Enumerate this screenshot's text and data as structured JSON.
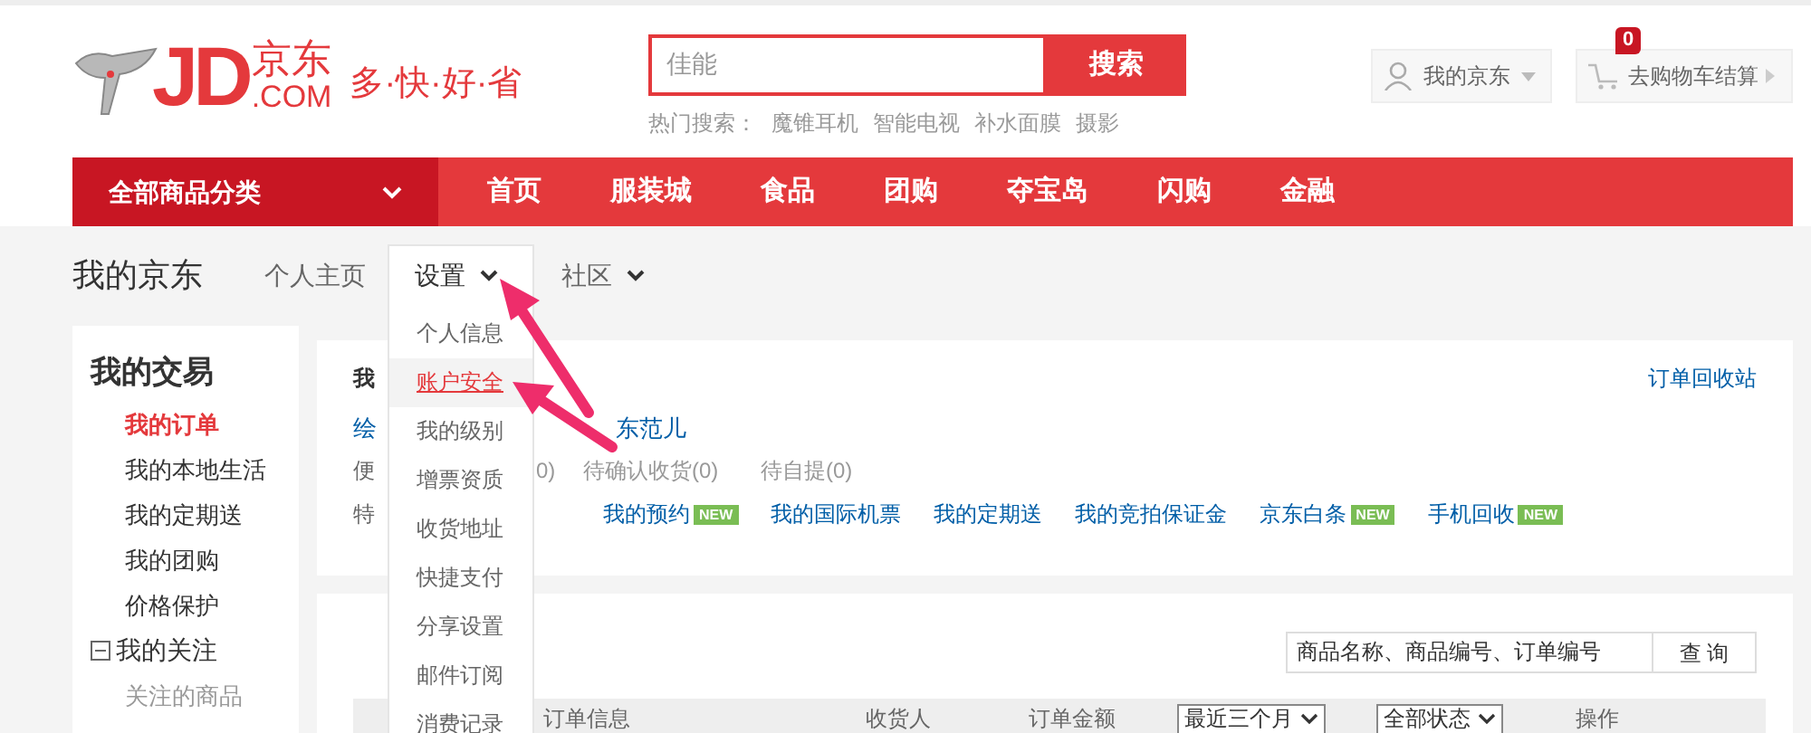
{
  "header": {
    "logo": {
      "brand": "JD",
      "cn": "京东",
      "domain": ".COM",
      "slogan": "多·快·好·省"
    },
    "search": {
      "value": "佳能",
      "button": "搜索",
      "hot_label": "热门搜索：",
      "hot": [
        "魔锥耳机",
        "智能电视",
        "补水面膜",
        "摄影"
      ]
    },
    "account": "我的京东",
    "cart": {
      "label": "去购物车结算",
      "count": "0"
    }
  },
  "nav": {
    "category": "全部商品分类",
    "items": [
      "首页",
      "服装城",
      "食品",
      "团购",
      "夺宝岛",
      "闪购",
      "金融"
    ]
  },
  "page": {
    "title": "我的京东",
    "tabs": [
      {
        "label": "个人主页",
        "has_menu": false,
        "expanded": false
      },
      {
        "label": "设置",
        "has_menu": true,
        "expanded": true
      },
      {
        "label": "社区",
        "has_menu": true,
        "expanded": false
      }
    ]
  },
  "settings_menu": {
    "items": [
      {
        "label": "个人信息",
        "selected": false
      },
      {
        "label": "账户安全",
        "selected": true
      },
      {
        "label": "我的级别",
        "selected": false
      },
      {
        "label": "增票资质",
        "selected": false
      },
      {
        "label": "收货地址",
        "selected": false
      },
      {
        "label": "快捷支付",
        "selected": false
      },
      {
        "label": "分享设置",
        "selected": false
      },
      {
        "label": "邮件订阅",
        "selected": false
      },
      {
        "label": "消费记录",
        "selected": false
      }
    ]
  },
  "sidebar": {
    "sections": [
      {
        "title": "我的交易",
        "collapsible": false,
        "expanded": true,
        "items": [
          {
            "label": "我的订单",
            "selected": true
          },
          {
            "label": "我的本地生活",
            "selected": false
          },
          {
            "label": "我的定期送",
            "selected": false
          },
          {
            "label": "我的团购",
            "selected": false
          },
          {
            "label": "价格保护",
            "selected": false
          }
        ]
      },
      {
        "title": "我的关注",
        "collapsible": true,
        "expanded": true,
        "items": [
          {
            "label": "关注的商品",
            "selected": false
          }
        ]
      }
    ]
  },
  "summary": {
    "heading": "我",
    "recycle_link": "订单回收站",
    "profile": [
      "绘",
      "东范儿"
    ],
    "status": {
      "label": "便",
      "counts": [
        "0)",
        "待确认收货(0)",
        "待自提(0)"
      ]
    },
    "features": {
      "label": "特",
      "links": [
        {
          "label": "我的预约",
          "badge": "NEW"
        },
        {
          "label": "我的国际机票"
        },
        {
          "label": "我的定期送"
        },
        {
          "label": "我的竞拍保证金"
        },
        {
          "label": "京东白条",
          "badge": "NEW"
        },
        {
          "label": "手机回收",
          "badge": "NEW"
        }
      ]
    }
  },
  "orders": {
    "search_value": "商品名称、商品编号、订单编号",
    "search_button": "查 询",
    "columns": [
      {
        "kind": "text",
        "label": "订单信息"
      },
      {
        "kind": "text",
        "label": "收货人"
      },
      {
        "kind": "text",
        "label": "订单金额"
      },
      {
        "kind": "select",
        "label": "最近三个月"
      },
      {
        "kind": "select",
        "label": "全部状态"
      },
      {
        "kind": "text",
        "label": "操作"
      }
    ]
  }
}
